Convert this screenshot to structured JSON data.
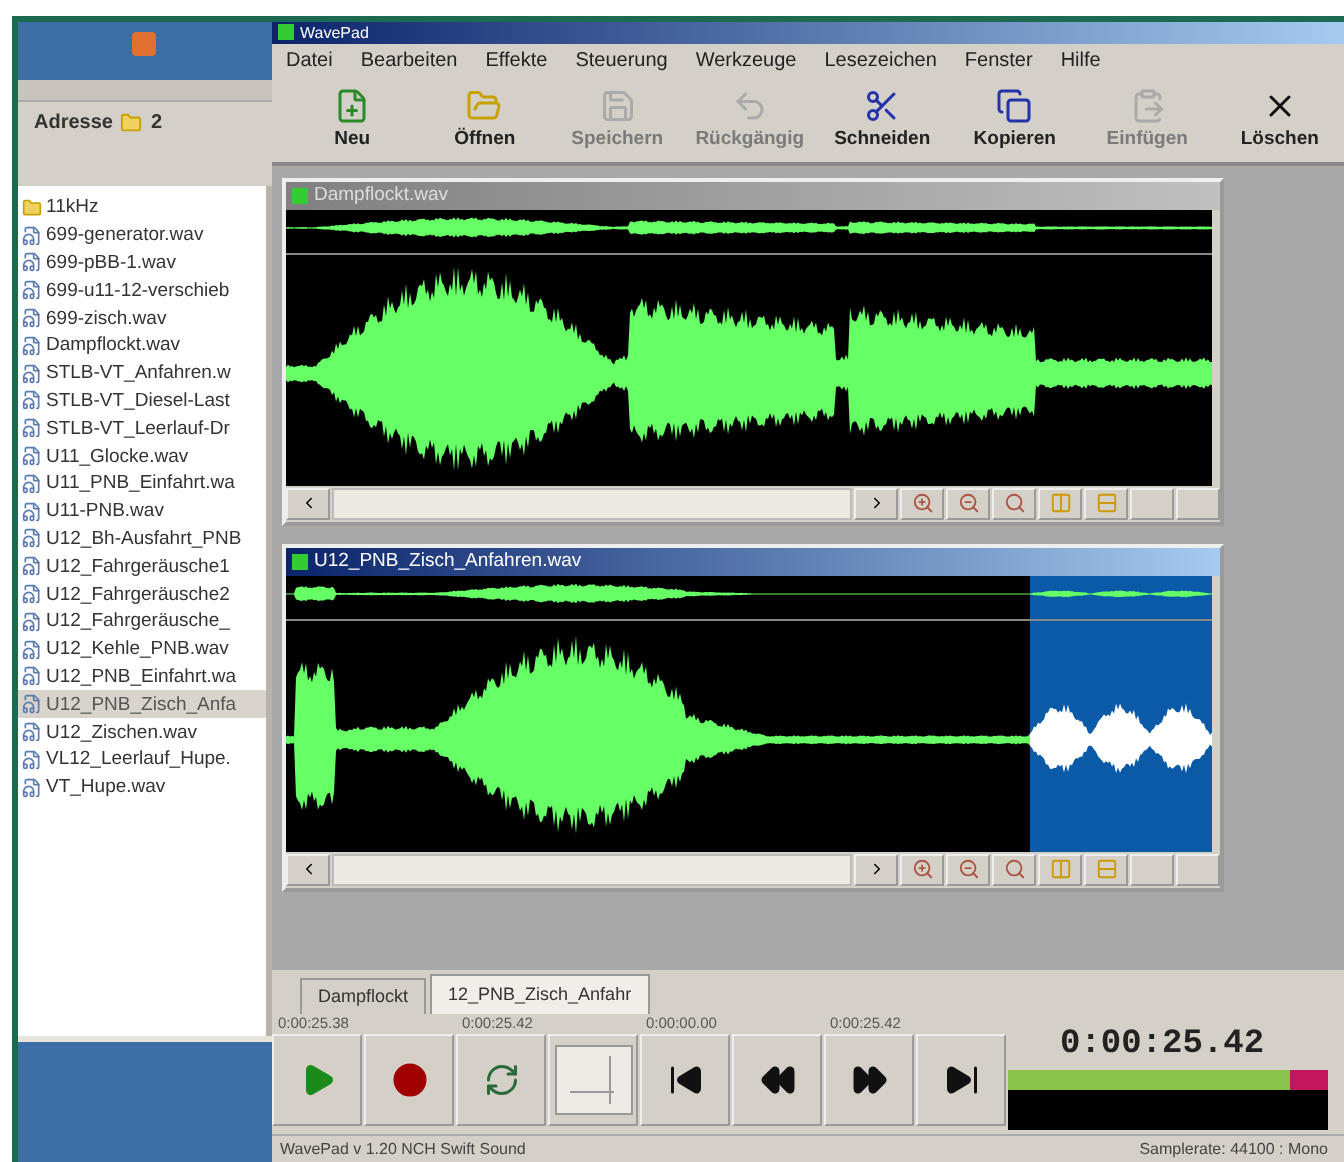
{
  "explorer": {
    "address_label": "Adresse",
    "address_value": "2",
    "files": [
      {
        "name": "11kHz",
        "kind": "folder",
        "selected": false
      },
      {
        "name": "699-generator.wav",
        "kind": "file",
        "selected": false
      },
      {
        "name": "699-pBB-1.wav",
        "kind": "file",
        "selected": false
      },
      {
        "name": "699-u11-12-verschieb",
        "kind": "file",
        "selected": false
      },
      {
        "name": "699-zisch.wav",
        "kind": "file",
        "selected": false
      },
      {
        "name": "Dampflockt.wav",
        "kind": "file",
        "selected": false
      },
      {
        "name": "STLB-VT_Anfahren.w",
        "kind": "file",
        "selected": false
      },
      {
        "name": "STLB-VT_Diesel-Last",
        "kind": "file",
        "selected": false
      },
      {
        "name": "STLB-VT_Leerlauf-Dr",
        "kind": "file",
        "selected": false
      },
      {
        "name": "U11_Glocke.wav",
        "kind": "file",
        "selected": false
      },
      {
        "name": "U11_PNB_Einfahrt.wa",
        "kind": "file",
        "selected": false
      },
      {
        "name": "U11-PNB.wav",
        "kind": "file",
        "selected": false
      },
      {
        "name": "U12_Bh-Ausfahrt_PNB",
        "kind": "file",
        "selected": false
      },
      {
        "name": "U12_Fahrgeräusche1",
        "kind": "file",
        "selected": false
      },
      {
        "name": "U12_Fahrgeräusche2",
        "kind": "file",
        "selected": false
      },
      {
        "name": "U12_Fahrgeräusche_",
        "kind": "file",
        "selected": false
      },
      {
        "name": "U12_Kehle_PNB.wav",
        "kind": "file",
        "selected": false
      },
      {
        "name": "U12_PNB_Einfahrt.wa",
        "kind": "file",
        "selected": false
      },
      {
        "name": "U12_PNB_Zisch_Anfa",
        "kind": "file",
        "selected": true
      },
      {
        "name": "U12_Zischen.wav",
        "kind": "file",
        "selected": false
      },
      {
        "name": "VL12_Leerlauf_Hupe.",
        "kind": "file",
        "selected": false
      },
      {
        "name": "VT_Hupe.wav",
        "kind": "file",
        "selected": false
      }
    ]
  },
  "window": {
    "title": "WavePad"
  },
  "menu": [
    "Datei",
    "Bearbeiten",
    "Effekte",
    "Steuerung",
    "Werkzeuge",
    "Lesezeichen",
    "Fenster",
    "Hilfe"
  ],
  "toolbar": [
    {
      "label": "Neu",
      "kind": "new",
      "disabled": false
    },
    {
      "label": "Öffnen",
      "kind": "open",
      "disabled": false
    },
    {
      "label": "Speichern",
      "kind": "save",
      "disabled": true
    },
    {
      "label": "Rückgängig",
      "kind": "undo",
      "disabled": true
    },
    {
      "label": "Schneiden",
      "kind": "cut",
      "disabled": false
    },
    {
      "label": "Kopieren",
      "kind": "copy",
      "disabled": false
    },
    {
      "label": "Einfügen",
      "kind": "paste",
      "disabled": true
    },
    {
      "label": "Löschen",
      "kind": "delete",
      "disabled": false
    }
  ],
  "documents": [
    {
      "title": "Dampflockt.wav",
      "active": false,
      "has_selection": false
    },
    {
      "title": "U12_PNB_Zisch_Anfahren.wav",
      "active": true,
      "has_selection": true
    }
  ],
  "tabs": [
    {
      "label": "Dampflockt",
      "selected": false
    },
    {
      "label": "12_PNB_Zisch_Anfahr",
      "selected": true
    }
  ],
  "transport": [
    {
      "time": "0:00:25.38",
      "kind": "play"
    },
    {
      "kind": "record"
    },
    {
      "time": "0:00:25.42",
      "kind": "loop"
    },
    {
      "kind": "blank"
    },
    {
      "time": "0:00:00.00",
      "kind": "start"
    },
    {
      "kind": "rewind"
    },
    {
      "time": "0:00:25.42",
      "kind": "forward"
    },
    {
      "kind": "end"
    }
  ],
  "clock": "0:00:25.42",
  "meter": {
    "level": 0.88
  },
  "status_bar": {
    "left": "WavePad v 1.20 NCH Swift Sound",
    "right": "Samplerate: 44100 : Mono"
  }
}
